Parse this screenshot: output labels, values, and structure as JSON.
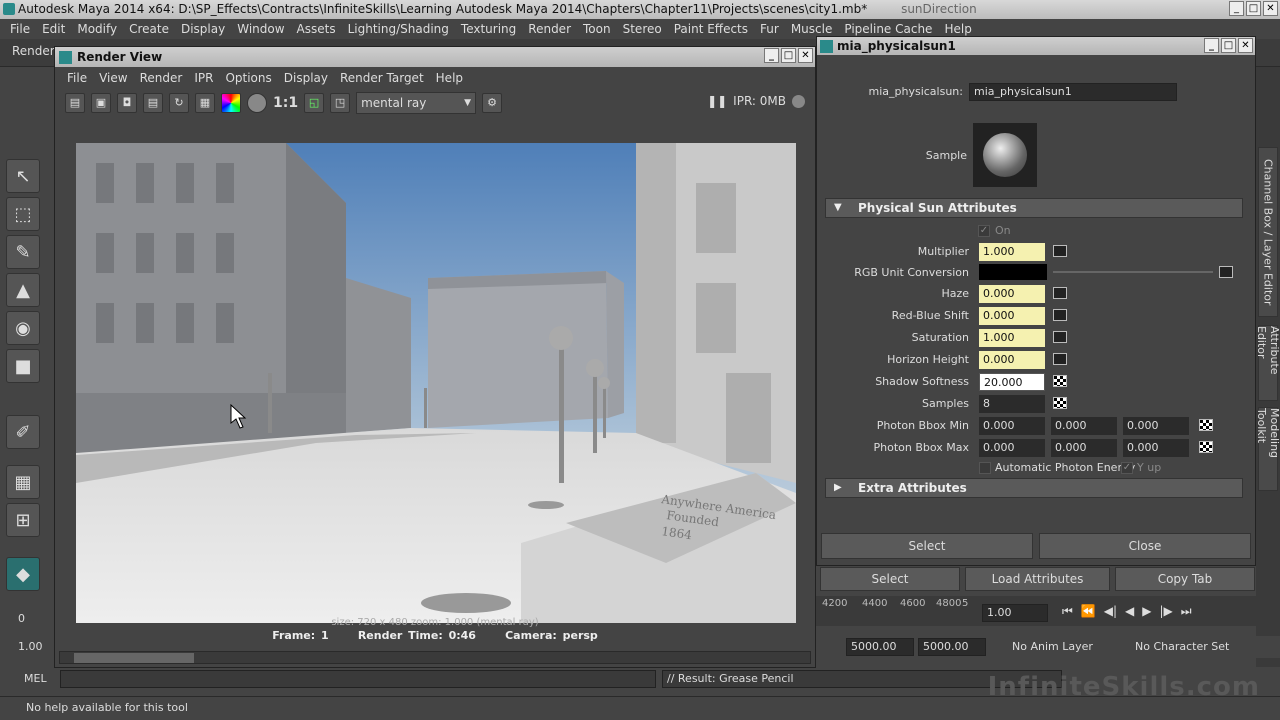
{
  "window": {
    "title": "Autodesk Maya 2014 x64: D:\\SP_Effects\\Contracts\\InfiniteSkills\\Learning Autodesk Maya 2014\\Chapters\\Chapter11\\Projects\\scenes\\city1.mb*",
    "title_ghost": "sunDirection"
  },
  "menu": [
    "File",
    "Edit",
    "Modify",
    "Create",
    "Display",
    "Window",
    "Assets",
    "Lighting/Shading",
    "Texturing",
    "Render",
    "Toon",
    "Stereo",
    "Paint Effects",
    "Fur",
    "Muscle",
    "Pipeline Cache",
    "Help"
  ],
  "shelf": {
    "tab_label": "Render"
  },
  "render_view": {
    "title": "Render View",
    "menu": [
      "File",
      "View",
      "Render",
      "IPR",
      "Options",
      "Display",
      "Render Target",
      "Help"
    ],
    "renderer": "mental ray",
    "ratio": "1:1",
    "ipr_memory": "IPR: 0MB",
    "status_top": "size: 720 x 480  zoom: 1.000       (mental ray)",
    "frame": "Frame: 1",
    "render_time": "Render Time: 0:46",
    "camera": "Camera: persp",
    "sign_text": [
      "Anywhere America",
      "Founded",
      "1864"
    ]
  },
  "attr_editor": {
    "title": "mia_physicalsun1",
    "node_label": "mia_physicalsun:",
    "node_value": "mia_physicalsun1",
    "sample_label": "Sample",
    "section_physical": "Physical Sun Attributes",
    "on_label": "On",
    "attrs": [
      {
        "label": "Multiplier",
        "value": "1.000"
      },
      {
        "label": "RGB Unit Conversion",
        "value": ""
      },
      {
        "label": "Haze",
        "value": "0.000"
      },
      {
        "label": "Red-Blue Shift",
        "value": "0.000"
      },
      {
        "label": "Saturation",
        "value": "1.000"
      },
      {
        "label": "Horizon Height",
        "value": "0.000"
      },
      {
        "label": "Shadow Softness",
        "value": "20.000"
      },
      {
        "label": "Samples",
        "value": "8"
      }
    ],
    "photon_min": {
      "label": "Photon Bbox Min",
      "values": [
        "0.000",
        "0.000",
        "0.000"
      ]
    },
    "photon_max": {
      "label": "Photon Bbox Max",
      "values": [
        "0.000",
        "0.000",
        "0.000"
      ]
    },
    "auto_photon": "Automatic Photon Energy",
    "y_up": "Y up",
    "section_extra": "Extra Attributes",
    "select_btn": "Select",
    "close_btn": "Close"
  },
  "main_ae_buttons": {
    "select": "Select",
    "load": "Load Attributes",
    "copy": "Copy Tab"
  },
  "side_tabs": [
    "Channel Box / Layer Editor",
    "Attribute Editor",
    "Modeling Toolkit"
  ],
  "timeline": {
    "ticks": [
      "4200",
      "4400",
      "4600",
      "4800",
      "5"
    ],
    "current": "1.00"
  },
  "range": {
    "left_value": "1.00",
    "end1": "5000.00",
    "end2": "5000.00",
    "anim_layer": "No Anim Layer",
    "char_set": "No Character Set"
  },
  "left_values": {
    "frame": "0",
    "start": "1.00"
  },
  "mel": {
    "label": "MEL",
    "result": "// Result: Grease Pencil"
  },
  "help_line": "No help available for this tool",
  "watermark": "InfiniteSkills.com"
}
